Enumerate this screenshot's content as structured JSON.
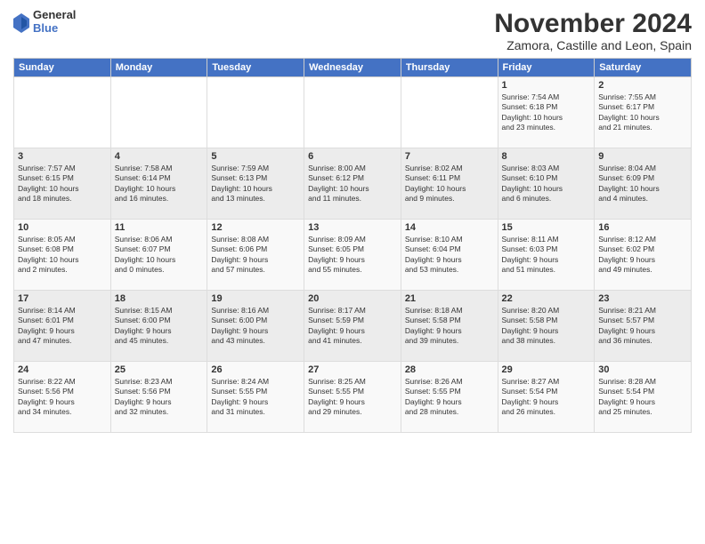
{
  "logo": {
    "general": "General",
    "blue": "Blue"
  },
  "title": "November 2024",
  "location": "Zamora, Castille and Leon, Spain",
  "headers": [
    "Sunday",
    "Monday",
    "Tuesday",
    "Wednesday",
    "Thursday",
    "Friday",
    "Saturday"
  ],
  "rows": [
    [
      {
        "day": "",
        "text": ""
      },
      {
        "day": "",
        "text": ""
      },
      {
        "day": "",
        "text": ""
      },
      {
        "day": "",
        "text": ""
      },
      {
        "day": "",
        "text": ""
      },
      {
        "day": "1",
        "text": "Sunrise: 7:54 AM\nSunset: 6:18 PM\nDaylight: 10 hours\nand 23 minutes."
      },
      {
        "day": "2",
        "text": "Sunrise: 7:55 AM\nSunset: 6:17 PM\nDaylight: 10 hours\nand 21 minutes."
      }
    ],
    [
      {
        "day": "3",
        "text": "Sunrise: 7:57 AM\nSunset: 6:15 PM\nDaylight: 10 hours\nand 18 minutes."
      },
      {
        "day": "4",
        "text": "Sunrise: 7:58 AM\nSunset: 6:14 PM\nDaylight: 10 hours\nand 16 minutes."
      },
      {
        "day": "5",
        "text": "Sunrise: 7:59 AM\nSunset: 6:13 PM\nDaylight: 10 hours\nand 13 minutes."
      },
      {
        "day": "6",
        "text": "Sunrise: 8:00 AM\nSunset: 6:12 PM\nDaylight: 10 hours\nand 11 minutes."
      },
      {
        "day": "7",
        "text": "Sunrise: 8:02 AM\nSunset: 6:11 PM\nDaylight: 10 hours\nand 9 minutes."
      },
      {
        "day": "8",
        "text": "Sunrise: 8:03 AM\nSunset: 6:10 PM\nDaylight: 10 hours\nand 6 minutes."
      },
      {
        "day": "9",
        "text": "Sunrise: 8:04 AM\nSunset: 6:09 PM\nDaylight: 10 hours\nand 4 minutes."
      }
    ],
    [
      {
        "day": "10",
        "text": "Sunrise: 8:05 AM\nSunset: 6:08 PM\nDaylight: 10 hours\nand 2 minutes."
      },
      {
        "day": "11",
        "text": "Sunrise: 8:06 AM\nSunset: 6:07 PM\nDaylight: 10 hours\nand 0 minutes."
      },
      {
        "day": "12",
        "text": "Sunrise: 8:08 AM\nSunset: 6:06 PM\nDaylight: 9 hours\nand 57 minutes."
      },
      {
        "day": "13",
        "text": "Sunrise: 8:09 AM\nSunset: 6:05 PM\nDaylight: 9 hours\nand 55 minutes."
      },
      {
        "day": "14",
        "text": "Sunrise: 8:10 AM\nSunset: 6:04 PM\nDaylight: 9 hours\nand 53 minutes."
      },
      {
        "day": "15",
        "text": "Sunrise: 8:11 AM\nSunset: 6:03 PM\nDaylight: 9 hours\nand 51 minutes."
      },
      {
        "day": "16",
        "text": "Sunrise: 8:12 AM\nSunset: 6:02 PM\nDaylight: 9 hours\nand 49 minutes."
      }
    ],
    [
      {
        "day": "17",
        "text": "Sunrise: 8:14 AM\nSunset: 6:01 PM\nDaylight: 9 hours\nand 47 minutes."
      },
      {
        "day": "18",
        "text": "Sunrise: 8:15 AM\nSunset: 6:00 PM\nDaylight: 9 hours\nand 45 minutes."
      },
      {
        "day": "19",
        "text": "Sunrise: 8:16 AM\nSunset: 6:00 PM\nDaylight: 9 hours\nand 43 minutes."
      },
      {
        "day": "20",
        "text": "Sunrise: 8:17 AM\nSunset: 5:59 PM\nDaylight: 9 hours\nand 41 minutes."
      },
      {
        "day": "21",
        "text": "Sunrise: 8:18 AM\nSunset: 5:58 PM\nDaylight: 9 hours\nand 39 minutes."
      },
      {
        "day": "22",
        "text": "Sunrise: 8:20 AM\nSunset: 5:58 PM\nDaylight: 9 hours\nand 38 minutes."
      },
      {
        "day": "23",
        "text": "Sunrise: 8:21 AM\nSunset: 5:57 PM\nDaylight: 9 hours\nand 36 minutes."
      }
    ],
    [
      {
        "day": "24",
        "text": "Sunrise: 8:22 AM\nSunset: 5:56 PM\nDaylight: 9 hours\nand 34 minutes."
      },
      {
        "day": "25",
        "text": "Sunrise: 8:23 AM\nSunset: 5:56 PM\nDaylight: 9 hours\nand 32 minutes."
      },
      {
        "day": "26",
        "text": "Sunrise: 8:24 AM\nSunset: 5:55 PM\nDaylight: 9 hours\nand 31 minutes."
      },
      {
        "day": "27",
        "text": "Sunrise: 8:25 AM\nSunset: 5:55 PM\nDaylight: 9 hours\nand 29 minutes."
      },
      {
        "day": "28",
        "text": "Sunrise: 8:26 AM\nSunset: 5:55 PM\nDaylight: 9 hours\nand 28 minutes."
      },
      {
        "day": "29",
        "text": "Sunrise: 8:27 AM\nSunset: 5:54 PM\nDaylight: 9 hours\nand 26 minutes."
      },
      {
        "day": "30",
        "text": "Sunrise: 8:28 AM\nSunset: 5:54 PM\nDaylight: 9 hours\nand 25 minutes."
      }
    ]
  ]
}
